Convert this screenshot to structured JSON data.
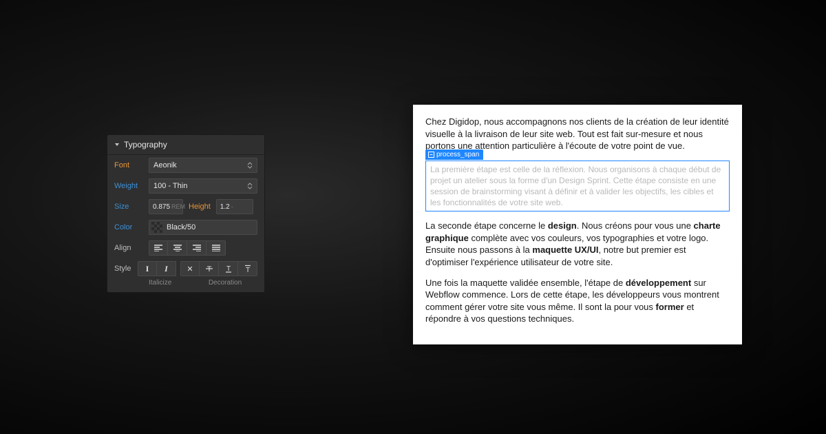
{
  "panel": {
    "title": "Typography",
    "font_label": "Font",
    "font_value": "Aeonik",
    "weight_label": "Weight",
    "weight_value": "100 - Thin",
    "size_label": "Size",
    "size_value": "0.875",
    "size_unit": "REM",
    "height_label": "Height",
    "height_value": "1.2",
    "height_unit": "-",
    "color_label": "Color",
    "color_value": "Black/50",
    "align_label": "Align",
    "style_label": "Style",
    "sublabel_italicize": "Italicize",
    "sublabel_decoration": "Decoration"
  },
  "selection": {
    "tag_label": "process_span"
  },
  "preview": {
    "p1": "Chez Digidop, nous accompagnons nos clients de la création de leur identité visuelle à la livraison de leur site web. Tout est fait sur-mesure et nous portons une attention particulière à l'écoute de votre point de vue.",
    "selected": "La première étape est celle de la réflexion. Nous organisons à chaque début de projet un atelier sous la forme d'un Design Sprint. Cette étape consiste en une session de brainstorming visant à définir et à valider les objectifs, les cibles et les fonctionnalités de votre site web.",
    "p2a": "La seconde étape concerne le ",
    "p2b": "design",
    "p2c": ". Nous créons pour vous une ",
    "p2d": "charte graphique",
    "p2e": " complète avec vos couleurs, vos typographies et votre logo. Ensuite nous passons à la ",
    "p2f": "maquette UX/UI",
    "p2g": ", notre but premier est d'optimiser l'expérience utilisateur de votre site.",
    "p3a": "Une fois la maquette validée ensemble, l'étape de ",
    "p3b": "développement",
    "p3c": " sur Webflow commence. Lors de cette étape, les développeurs vous montrent comment gérer votre site vous même. Il sont la pour vous ",
    "p3d": "former",
    "p3e": " et répondre à vos questions techniques."
  }
}
